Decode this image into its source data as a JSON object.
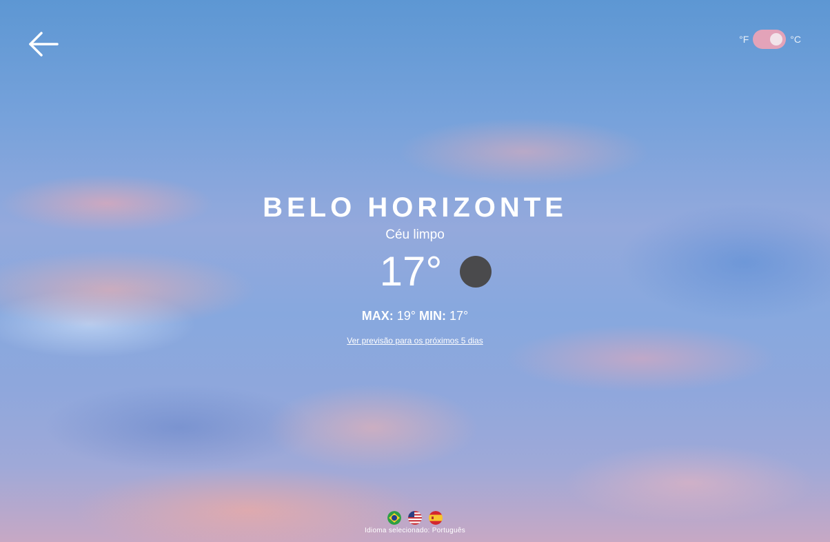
{
  "units": {
    "fahrenheit_label": "°F",
    "celsius_label": "°C",
    "selected": "°C"
  },
  "weather": {
    "city": "BELO HORIZONTE",
    "description": "Céu limpo",
    "temperature": "17°",
    "max_label": "MAX:",
    "max_value": "19°",
    "min_label": "MIN:",
    "min_value": "17°",
    "forecast_link": "Ver previsão para os próximos 5 dias"
  },
  "languages": {
    "options": [
      "brazil-flag-icon",
      "usa-flag-icon",
      "spain-flag-icon"
    ],
    "selected_text": "Idioma selecionado: Português"
  },
  "colors": {
    "toggle_track": "#e3a3b9",
    "weather_icon": "#4a4a4c"
  }
}
